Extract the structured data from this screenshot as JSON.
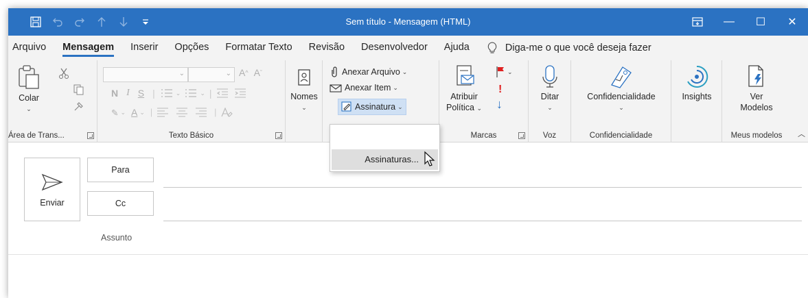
{
  "window": {
    "title": "Sem título  -  Mensagem (HTML)"
  },
  "qat": [
    {
      "name": "save-icon"
    },
    {
      "name": "undo-icon"
    },
    {
      "name": "redo-icon"
    },
    {
      "name": "arrow-up-icon"
    },
    {
      "name": "arrow-down-icon"
    },
    {
      "name": "customize-qat-icon"
    }
  ],
  "window_controls": {
    "ribbon_options": "ribbon-display-options-icon",
    "minimize": "—",
    "maximize": "☐",
    "close": "✕"
  },
  "tabs": [
    "Arquivo",
    "Mensagem",
    "Inserir",
    "Opções",
    "Formatar Texto",
    "Revisão",
    "Desenvolvedor",
    "Ajuda"
  ],
  "active_tab": "Mensagem",
  "tell_me": "Diga-me o que você deseja fazer",
  "ribbon": {
    "clipboard": {
      "paste": "Colar",
      "label": "Área de Trans..."
    },
    "basic_text": {
      "bold": "N",
      "italic": "I",
      "underline": "S",
      "font_grow": "A",
      "font_shrink": "A",
      "highlight": "✎",
      "font_color": "A",
      "label": "Texto Básico"
    },
    "names": {
      "label": "Nomes"
    },
    "include": {
      "attach_file": "Anexar Arquivo",
      "attach_item": "Anexar Item",
      "signature": "Assinatura"
    },
    "tags": {
      "assign_policy_1": "Atribuir",
      "assign_policy_2": "Política",
      "label": "Marcas"
    },
    "voice": {
      "dictate": "Ditar",
      "label": "Voz"
    },
    "sensitivity": {
      "button": "Confidencialidade",
      "label": "Confidencialidade"
    },
    "insights": {
      "button": "Insights"
    },
    "templates": {
      "button_1": "Ver",
      "button_2": "Modelos",
      "label": "Meus modelos"
    }
  },
  "signature_menu": {
    "item": "Assinaturas..."
  },
  "compose": {
    "send": "Enviar",
    "to": "Para",
    "cc": "Cc",
    "subject": "Assunto"
  },
  "colors": {
    "accent": "#2b72c2",
    "ribbon_bg": "#f3f3f3",
    "flag_red": "#e02020",
    "importance_blue": "#2b72c2"
  }
}
